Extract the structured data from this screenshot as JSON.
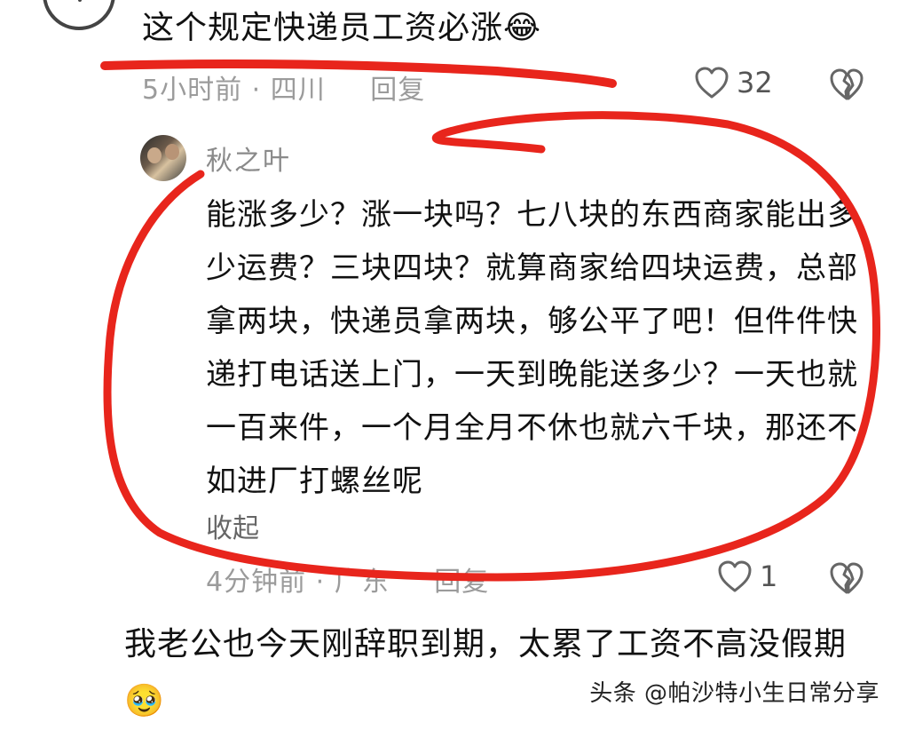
{
  "comment1": {
    "text": "这个规定快递员工资必涨",
    "emoji": "😂",
    "time": "5小时前",
    "location": "四川",
    "reply_label": "回复",
    "likes": "32"
  },
  "reply": {
    "username": "秋之叶",
    "body": "能涨多少？涨一块吗？七八块的东西商家能出多少运费？三块四块？就算商家给四块运费，总部拿两块，快递员拿两块，够公平了吧！但件件快递打电话送上门，一天到晚能送多少？一天也就一百来件，一个月全月不休也就六千块，那还不如进厂打螺丝呢",
    "collapse_label": "收起",
    "time": "4分钟前",
    "location": "广东",
    "reply_label": "回复",
    "likes": "1"
  },
  "comment2": {
    "text": "我老公也今天刚辞职到期，太累了工资不高没假期",
    "emoji": "🥹"
  },
  "watermark": "头条 @帕沙特小生日常分享",
  "icons": {
    "like": "heart-icon",
    "dislike": "broken-heart-icon"
  },
  "colors": {
    "annotation": "#e8251c",
    "meta": "#9b9b9b"
  }
}
